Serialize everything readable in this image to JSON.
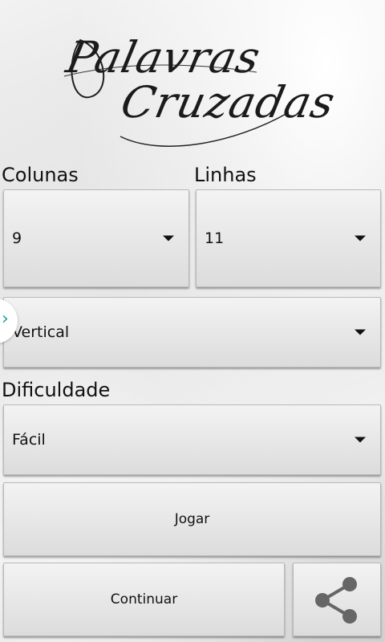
{
  "logo": {
    "line1": "Palavras",
    "line2": "Cruzadas"
  },
  "columns": {
    "label": "Colunas",
    "value": "9"
  },
  "rows": {
    "label": "Linhas",
    "value": "11"
  },
  "orientation": {
    "value": "Vertical"
  },
  "difficulty": {
    "label": "Dificuldade",
    "value": "Fácil"
  },
  "actions": {
    "play_label": "Jogar",
    "continue_label": "Continuar"
  },
  "icons": {
    "share": "share-icon",
    "side_tab": "chevron-right-icon",
    "dropdown": "caret-down-icon"
  },
  "colors": {
    "accent": "#1aa0a0"
  }
}
